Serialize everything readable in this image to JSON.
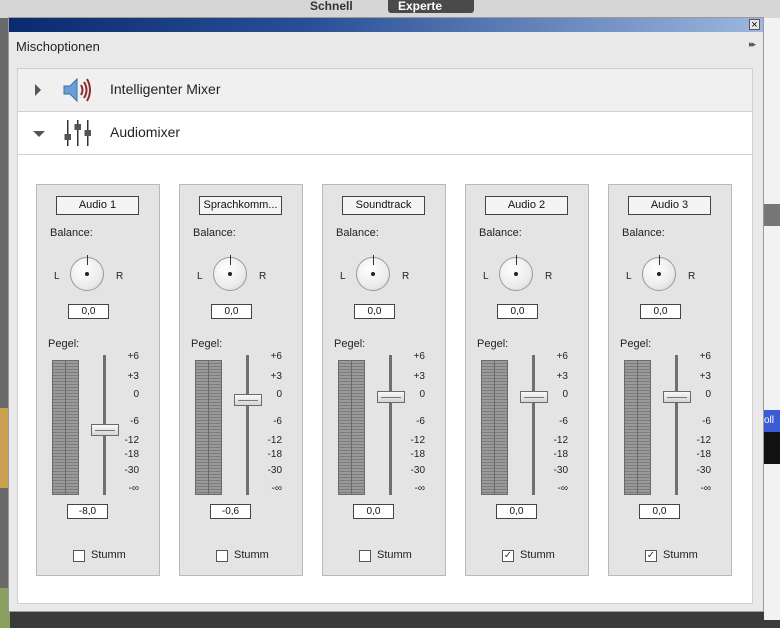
{
  "background": {
    "tab_quick": "Schnell",
    "tab_expert": "Experte",
    "right_clip_label": "oll"
  },
  "dialog": {
    "title": "Mischoptionen",
    "close_glyph": "×",
    "more_glyph": "▸▸"
  },
  "sections": [
    {
      "label": "Intelligenter Mixer",
      "expanded": false,
      "icon": "speaker-icon"
    },
    {
      "label": "Audiomixer",
      "expanded": true,
      "icon": "mixer-faders-icon"
    }
  ],
  "labels": {
    "balance": "Balance:",
    "pan_left": "L",
    "pan_right": "R",
    "level": "Pegel:",
    "mute": "Stumm"
  },
  "scale_ticks": [
    "+6",
    "+3",
    "0",
    "-6",
    "-12",
    "-18",
    "-30",
    "-∞"
  ],
  "channels": [
    {
      "name": "Audio 1",
      "balance": "0,0",
      "gain": "-8,0",
      "gain_db": -8.0,
      "muted": false
    },
    {
      "name": "Sprachkomm...",
      "balance": "0,0",
      "gain": "-0,6",
      "gain_db": -0.6,
      "muted": false
    },
    {
      "name": "Soundtrack",
      "balance": "0,0",
      "gain": "0,0",
      "gain_db": 0.0,
      "muted": false
    },
    {
      "name": "Audio 2",
      "balance": "0,0",
      "gain": "0,0",
      "gain_db": 0.0,
      "muted": true
    },
    {
      "name": "Audio 3",
      "balance": "0,0",
      "gain": "0,0",
      "gain_db": 0.0,
      "muted": true
    }
  ],
  "colors": {
    "titlebar_start": "#0b2a6e",
    "titlebar_end": "#9cb6dd",
    "panel_bg": "#e4e4e4"
  }
}
